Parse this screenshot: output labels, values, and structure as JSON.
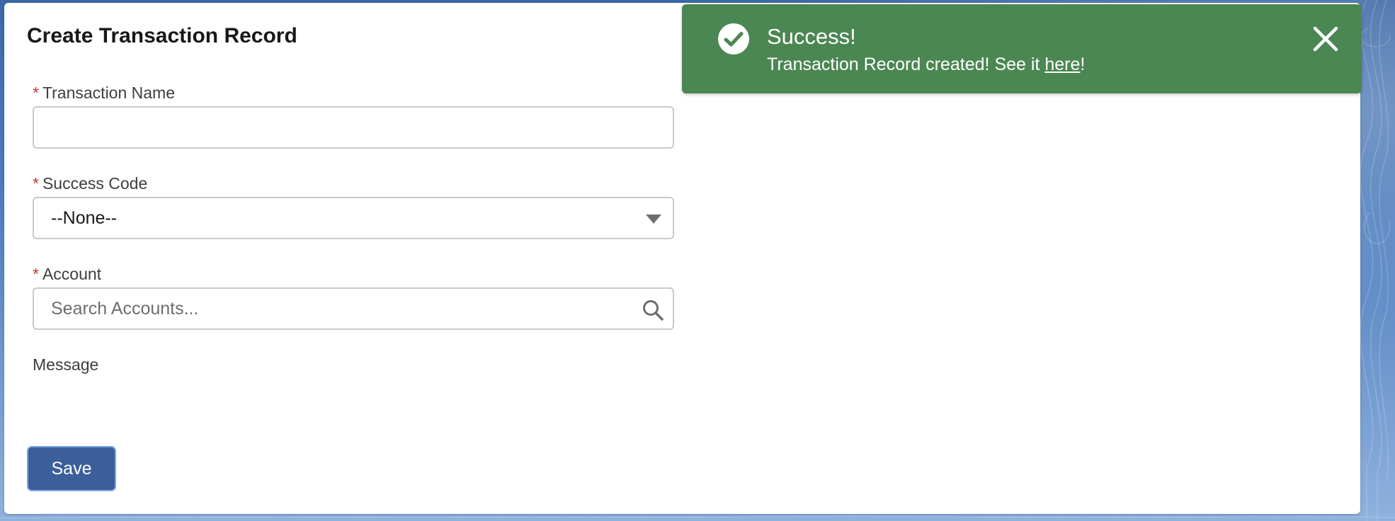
{
  "form": {
    "title": "Create Transaction Record",
    "fields": {
      "transaction_name": {
        "label": "Transaction Name",
        "required_mark": "*",
        "value": ""
      },
      "success_code": {
        "label": "Success Code",
        "required_mark": "*",
        "selected": "--None--"
      },
      "account": {
        "label": "Account",
        "required_mark": "*",
        "placeholder": "Search Accounts..."
      },
      "message": {
        "label": "Message"
      }
    },
    "save_label": "Save"
  },
  "toast": {
    "title": "Success!",
    "message_prefix": "Transaction Record created! See it ",
    "link_text": "here",
    "message_suffix": "!",
    "color": "#4b8752"
  },
  "icons": {
    "toast_icon": "success-check-icon",
    "close_icon": "close-icon",
    "search_icon": "search-icon",
    "dropdown_icon": "caret-down-icon"
  },
  "colors": {
    "required": "#c23934",
    "save_button": "#3b5f9a"
  }
}
